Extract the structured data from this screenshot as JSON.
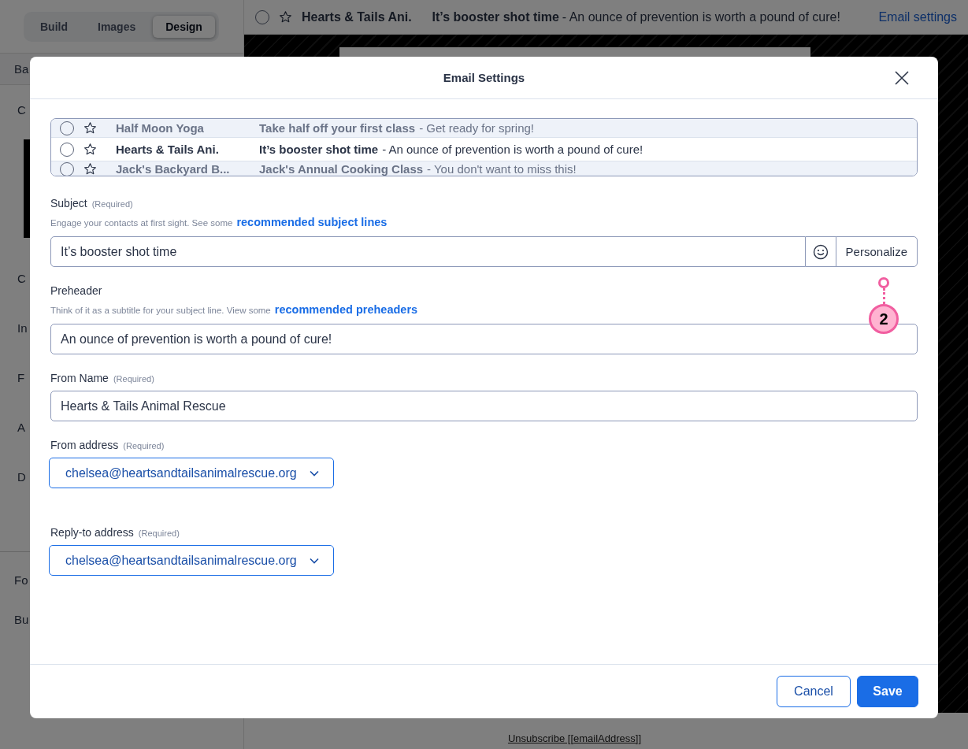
{
  "editor_tabs": [
    {
      "label": "Build",
      "selected": false
    },
    {
      "label": "Images",
      "selected": false
    },
    {
      "label": "Design",
      "selected": true
    }
  ],
  "sidebar_top_item": "Ba",
  "sidebar_items": [
    "C",
    "C",
    "In",
    "F",
    "A",
    "D"
  ],
  "sidebar_footer_items": [
    "Fo",
    "Bu"
  ],
  "preview_bar": {
    "sender": "Hearts & Tails Ani.",
    "subject": "It’s booster shot time",
    "preheader": "- An ounce of prevention is worth a pound of cure!",
    "link": "Email settings"
  },
  "footer_link": "Unsubscribe [[emailAddress]]",
  "dialog": {
    "title": "Email Settings",
    "inbox_rows": [
      {
        "sender": "Half Moon Yoga",
        "subject": "Take half off your first class",
        "preheader": "- Get ready for spring!",
        "selected": false
      },
      {
        "sender": "Hearts & Tails Ani.",
        "subject": "It’s booster shot time",
        "preheader": "- An ounce of prevention is worth a pound of cure!",
        "selected": true
      },
      {
        "sender": "Jack's Backyard B...",
        "subject": "Jack's Annual Cooking Class",
        "preheader": "- You don't want to miss this!",
        "selected": false
      }
    ],
    "fields": [
      {
        "kind": "text",
        "label": "Subject",
        "note": "(Required)",
        "hint": "Engage your contacts at first sight. See some",
        "hint_link": "recommended subject lines",
        "value": "It’s booster shot time",
        "emoji_picker": true,
        "button": "Personalize"
      },
      {
        "kind": "text",
        "label": "Preheader",
        "hint": "Think of it as a subtitle for your subject line. View some",
        "hint_link": "recommended preheaders",
        "value": "An ounce of prevention is worth a pound of cure!"
      },
      {
        "kind": "text",
        "label": "From Name",
        "note": "(Required)",
        "value": "Hearts & Tails Animal Rescue"
      },
      {
        "kind": "select",
        "label": "From address",
        "note": "(Required)",
        "value": "chelsea@heartsandtailsanimalrescue.org"
      },
      {
        "kind": "select",
        "label": "Reply-to address",
        "note": "(Required)",
        "value": "chelsea@heartsandtailsanimalrescue.org"
      }
    ],
    "buttons": [
      {
        "label": "Cancel",
        "kind": "secondary"
      },
      {
        "label": "Save",
        "kind": "primary"
      }
    ],
    "annotation": {
      "label": "2"
    }
  }
}
